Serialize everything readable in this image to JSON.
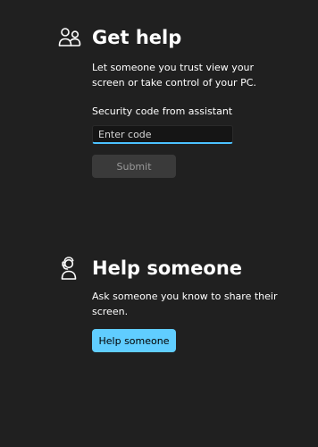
{
  "theme": {
    "background": "#202020",
    "accent": "#60cdff",
    "input_underline": "#4cc2ff",
    "disabled_button_bg": "#3a3a3a",
    "disabled_button_text": "#9a9a9a"
  },
  "get_help": {
    "icon": "people-icon",
    "title": "Get help",
    "description": "Let someone you trust view your screen or take control of your PC.",
    "field_label": "Security code from assistant",
    "input": {
      "placeholder": "Enter code",
      "value": ""
    },
    "submit_label": "Submit"
  },
  "help_someone": {
    "icon": "person-helper-icon",
    "title": "Help someone",
    "description": "Ask someone you know to share their screen.",
    "button_label": "Help someone"
  }
}
